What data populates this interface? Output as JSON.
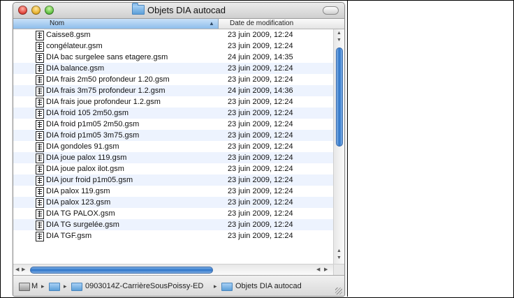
{
  "window": {
    "title": "Objets DIA autocad"
  },
  "columns": {
    "name": "Nom",
    "date": "Date de modification"
  },
  "files": [
    {
      "name": "Caisse8.gsm",
      "date": "23 juin 2009, 12:24"
    },
    {
      "name": "congélateur.gsm",
      "date": "23 juin 2009, 12:24"
    },
    {
      "name": "DIA bac surgelee sans etagere.gsm",
      "date": "24 juin 2009, 14:35"
    },
    {
      "name": "DIA balance.gsm",
      "date": "23 juin 2009, 12:24"
    },
    {
      "name": "DIA frais 2m50 profondeur 1.20.gsm",
      "date": "23 juin 2009, 12:24"
    },
    {
      "name": "DIA frais 3m75 profondeur 1.2.gsm",
      "date": "24 juin 2009, 14:36"
    },
    {
      "name": "DIA frais joue profondeur 1.2.gsm",
      "date": "23 juin 2009, 12:24"
    },
    {
      "name": "DIA froid 105 2m50.gsm",
      "date": "23 juin 2009, 12:24"
    },
    {
      "name": "DIA froid p1m05 2m50.gsm",
      "date": "23 juin 2009, 12:24"
    },
    {
      "name": "DIA froid p1m05 3m75.gsm",
      "date": "23 juin 2009, 12:24"
    },
    {
      "name": "DIA gondoles 91.gsm",
      "date": "23 juin 2009, 12:24"
    },
    {
      "name": "DIA joue palox 119.gsm",
      "date": "23 juin 2009, 12:24"
    },
    {
      "name": "DIA joue palox ilot.gsm",
      "date": "23 juin 2009, 12:24"
    },
    {
      "name": "DIA jour froid p1m05.gsm",
      "date": "23 juin 2009, 12:24"
    },
    {
      "name": "DIA palox 119.gsm",
      "date": "23 juin 2009, 12:24"
    },
    {
      "name": "DIA palox 123.gsm",
      "date": "23 juin 2009, 12:24"
    },
    {
      "name": "DIA TG PALOX.gsm",
      "date": "23 juin 2009, 12:24"
    },
    {
      "name": "DIA TG surgelée.gsm",
      "date": "23 juin 2009, 12:24"
    },
    {
      "name": "DIA TGF.gsm",
      "date": "23 juin 2009, 12:24"
    }
  ],
  "pathbar": {
    "drive": "M",
    "segment1": "0903014Z-CarrièreSousPoissy-ED",
    "segment2": "Objets DIA autocad",
    "separator": "▸"
  },
  "icons": {
    "close": "close-icon",
    "minimize": "minimize-icon",
    "zoom": "zoom-icon",
    "folder": "folder-icon",
    "file": "document-icon",
    "sort": "sort-ascending-icon"
  },
  "colors": {
    "selected_header": "#8ebdeb",
    "scroll_thumb": "#2e74c8",
    "row_alt": "#edf3fe"
  }
}
